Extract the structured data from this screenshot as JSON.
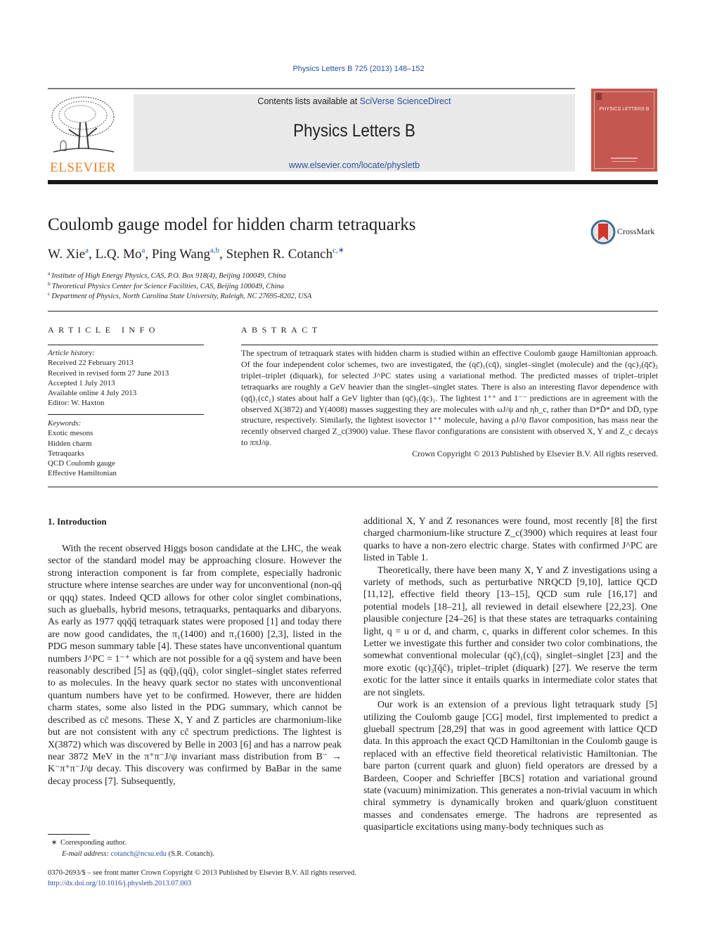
{
  "header": {
    "journal_ref": "Physics Letters B 725 (2013) 148–152",
    "contents_prefix": "Contents lists available at ",
    "contents_link": "SciVerse ScienceDirect",
    "journal_title": "Physics Letters B",
    "journal_url": "www.elsevier.com/locate/physletb",
    "publisher_logo_text": "ELSEVIER",
    "cover_title": "PHYSICS LETTERS B",
    "crossmark_label": "CrossMark"
  },
  "article": {
    "title": "Coulomb gauge model for hidden charm tetraquarks",
    "authors": [
      {
        "name": "W. Xie",
        "sup": "a"
      },
      {
        "name": "L.Q. Mo",
        "sup": "a"
      },
      {
        "name": "Ping Wang",
        "sup": "a,b"
      },
      {
        "name": "Stephen R. Cotanch",
        "sup": "c,∗"
      }
    ],
    "affiliations": [
      {
        "mark": "a",
        "text": "Institute of High Energy Physics, CAS, P.O. Box 918(4), Beijing 100049, China"
      },
      {
        "mark": "b",
        "text": "Theoretical Physics Center for Science Facilities, CAS, Beijing 100049, China"
      },
      {
        "mark": "c",
        "text": "Department of Physics, North Carolina State University, Raleigh, NC 27695-8202, USA"
      }
    ]
  },
  "article_info": {
    "heading": "ARTICLE INFO",
    "history_label": "Article history:",
    "history": [
      "Received 22 February 2013",
      "Received in revised form 27 June 2013",
      "Accepted 1 July 2013",
      "Available online 4 July 2013",
      "Editor: W. Haxton"
    ],
    "keywords_label": "Keywords:",
    "keywords": [
      "Exotic mesons",
      "Hidden charm",
      "Tetraquarks",
      "QCD Coulomb gauge",
      "Effective Hamiltonian"
    ]
  },
  "abstract": {
    "heading": "ABSTRACT",
    "text": "The spectrum of tetraquark states with hidden charm is studied within an effective Coulomb gauge Hamiltonian approach. Of the four independent color schemes, two are investigated, the (qc̄)₁(cq̄)₁ singlet–singlet (molecule) and the (qc)₃(q̄c̄)₃ triplet–triplet (diquark), for selected J^PC states using a variational method. The predicted masses of triplet–triplet tetraquarks are roughly a GeV heavier than the singlet–singlet states. There is also an interesting flavor dependence with (qq̄)₁(cc̄₁) states about half a GeV lighter than (qc̄)₁(q̄c)₁. The lightest 1⁺⁺ and 1⁻⁻ predictions are in agreement with the observed X(3872) and Y(4008) masses suggesting they are molecules with ωJ/ψ and ηh_c, rather than D*D̄* and DD̄, type structure, respectively. Similarly, the lightest isovector 1⁺⁺ molecule, having a ρJ/ψ flavor composition, has mass near the recently observed charged Z_c(3900) value. These flavor configurations are consistent with observed X, Y and Z_c decays to ππJ/ψ.",
    "copyright": "Crown Copyright © 2013 Published by Elsevier B.V. All rights reserved."
  },
  "body": {
    "section_heading": "1.  Introduction",
    "left_column": "With the recent observed Higgs boson candidate at the LHC, the weak sector of the standard model may be approaching closure. However the strong interaction component is far from complete, especially hadronic structure where intense searches are under way for unconventional (non-qq̄ or qqq) states. Indeed QCD allows for other color singlet combinations, such as glueballs, hybrid mesons, tetraquarks, pentaquarks and dibaryons. As early as 1977 qqq̄q̄ tetraquark states were proposed [1] and today there are now good candidates, the π₁(1400) and π₁(1600) [2,3], listed in the PDG meson summary table [4]. These states have unconventional quantum numbers J^PC = 1⁻⁺ which are not possible for a qq̄ system and have been reasonably described [5] as (qq̄)₁(qq̄)₁ color singlet–singlet states referred to as molecules. In the heavy quark sector no states with unconventional quantum numbers have yet to be confirmed. However, there are hidden charm states, some also listed in the PDG summary, which cannot be described as cc̄ mesons. These X, Y and Z particles are charmonium-like but are not consistent with any cc̄ spectrum predictions. The lightest is X(3872) which was discovered by Belle in 2003 [6] and has a narrow peak near 3872 MeV in the π⁺π⁻J/ψ invariant mass distribution from B⁻ → K⁻π⁺π⁻J/ψ decay. This discovery was confirmed by BaBar in the same decay process [7]. Subsequently,",
    "right_column_p1": "additional X, Y and Z resonances were found, most recently [8] the first charged charmonium-like structure Z_c(3900) which requires at least four quarks to have a non-zero electric charge. States with confirmed J^PC are listed in Table 1.",
    "right_column_p2": "Theoretically, there have been many X, Y and Z investigations using a variety of methods, such as perturbative NRQCD [9,10], lattice QCD [11,12], effective field theory [13–15], QCD sum rule [16,17] and potential models [18–21], all reviewed in detail elsewhere [22,23]. One plausible conjecture [24–26] is that these states are tetraquarks containing light, q = u or d, and charm, c, quarks in different color schemes. In this Letter we investigate this further and consider two color combinations, the somewhat conventional molecular (qc̄)₁(cq̄)₁ singlet–singlet [23] and the more exotic (qc)₃̄(q̄c̄)₃ triplet–triplet (diquark) [27]. We reserve the term exotic for the latter since it entails quarks in intermediate color states that are not singlets.",
    "right_column_p3": "Our work is an extension of a previous light tetraquark study [5] utilizing the Coulomb gauge [CG] model, first implemented to predict a glueball spectrum [28,29] that was in good agreement with lattice QCD data. In this approach the exact QCD Hamiltonian in the Coulomb gauge is replaced with an effective field theoretical relativistic Hamiltonian. The bare parton (current quark and gluon) field operators are dressed by a Bardeen, Cooper and Schrieffer [BCS] rotation and variational ground state (vacuum) minimization. This generates a non-trivial vacuum in which chiral symmetry is dynamically broken and quark/gluon constituent masses and condensates emerge. The hadrons are represented as quasiparticle excitations using many-body techniques such as"
  },
  "footnote": {
    "marker": "∗",
    "text": "Corresponding author.",
    "email_label": "E-mail address:",
    "email": "cotanch@ncsu.edu",
    "email_owner": "(S.R. Cotanch)."
  },
  "front_matter": {
    "issn_line": "0370-2693/$ – see front matter  Crown Copyright © 2013 Published by Elsevier B.V. All rights reserved.",
    "doi": "http://dx.doi.org/10.1016/j.physletb.2013.07.003"
  }
}
